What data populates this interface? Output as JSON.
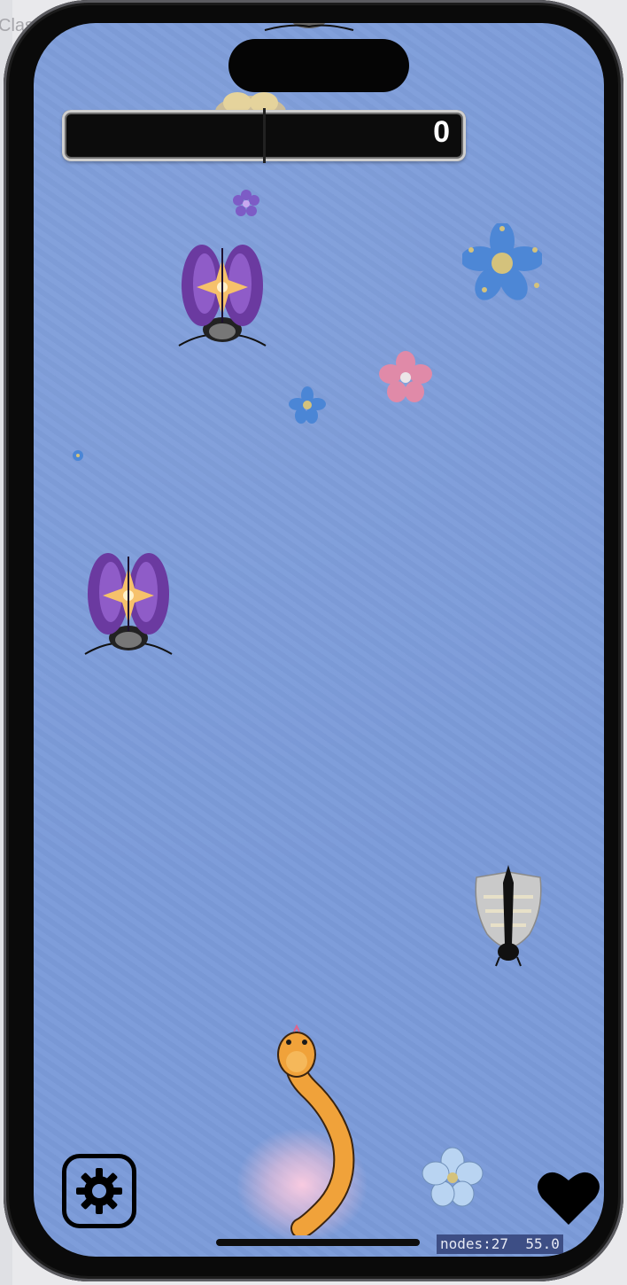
{
  "background_app": {
    "partial_label": "Class"
  },
  "hud": {
    "score": "0",
    "stats_nodes": "nodes:27",
    "stats_fps": "55.0"
  },
  "controls": {
    "settings_icon": "gear-icon",
    "lives_icon": "heart-icon"
  },
  "colors": {
    "field": "#7b9bd9",
    "snake": "#f0a23a",
    "beetle_shell": "#6b3aa0",
    "star": "#f6c16b"
  },
  "sprites": {
    "beetles": 3,
    "moths": 1,
    "flowers": 7,
    "snake": 1
  }
}
